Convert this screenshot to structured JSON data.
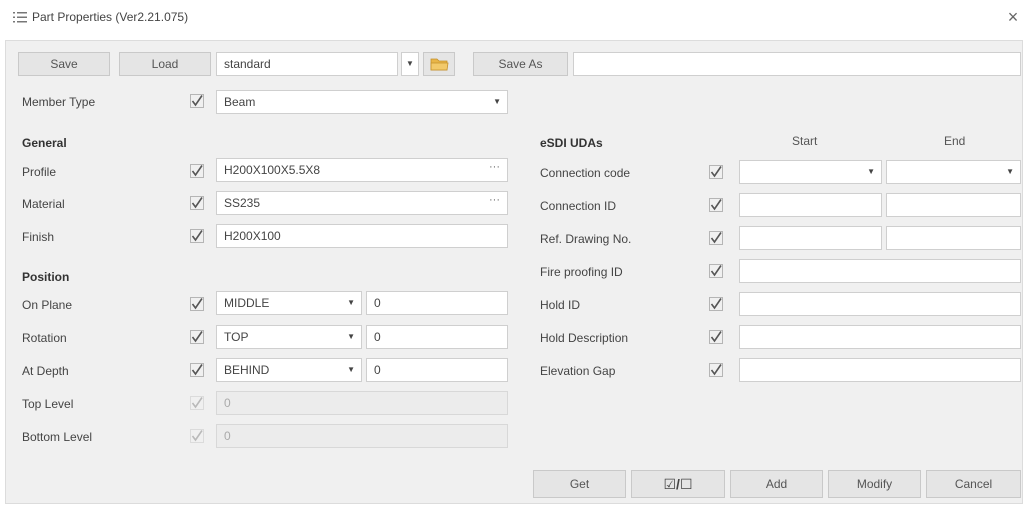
{
  "window": {
    "title": "Part Properties (Ver2.21.075)",
    "close": "×"
  },
  "toolbar": {
    "save_label": "Save",
    "load_label": "Load",
    "preset_value": "standard",
    "save_as_label": "Save As",
    "save_as_name": ""
  },
  "member_type": {
    "label": "Member Type",
    "value": "Beam"
  },
  "general": {
    "header": "General",
    "profile": {
      "label": "Profile",
      "value": "H200X100X5.5X8",
      "more": "···"
    },
    "material": {
      "label": "Material",
      "value": "SS235",
      "more": "···"
    },
    "finish": {
      "label": "Finish",
      "value": "H200X100"
    }
  },
  "position": {
    "header": "Position",
    "on_plane": {
      "label": "On Plane",
      "option": "MIDDLE",
      "value": "0"
    },
    "rotation": {
      "label": "Rotation",
      "option": "TOP",
      "value": "0"
    },
    "at_depth": {
      "label": "At Depth",
      "option": "BEHIND",
      "value": "0"
    },
    "top_level": {
      "label": "Top Level",
      "value": "0"
    },
    "bottom_level": {
      "label": "Bottom Level",
      "value": "0"
    }
  },
  "uda": {
    "header": "eSDI UDAs",
    "start_header": "Start",
    "end_header": "End",
    "connection_code": {
      "label": "Connection code",
      "start": "",
      "end": ""
    },
    "connection_id": {
      "label": "Connection ID",
      "start": "",
      "end": ""
    },
    "ref_drawing": {
      "label": "Ref. Drawing No.",
      "start": "",
      "end": ""
    },
    "fire_proofing": {
      "label": "Fire proofing ID",
      "value": ""
    },
    "hold_id": {
      "label": "Hold ID",
      "value": ""
    },
    "hold_description": {
      "label": "Hold Description",
      "value": ""
    },
    "elevation_gap": {
      "label": "Elevation Gap",
      "value": ""
    }
  },
  "footer": {
    "get_label": "Get",
    "toggle_label": "☑/☐",
    "add_label": "Add",
    "modify_label": "Modify",
    "cancel_label": "Cancel"
  },
  "icons": {
    "title": "list-icon",
    "checkbox": "checkmark-icon",
    "folder": "folder-icon",
    "dropdown": "chevron-down-icon"
  },
  "colors": {
    "folder": "#e8b548",
    "check": "#555555"
  }
}
